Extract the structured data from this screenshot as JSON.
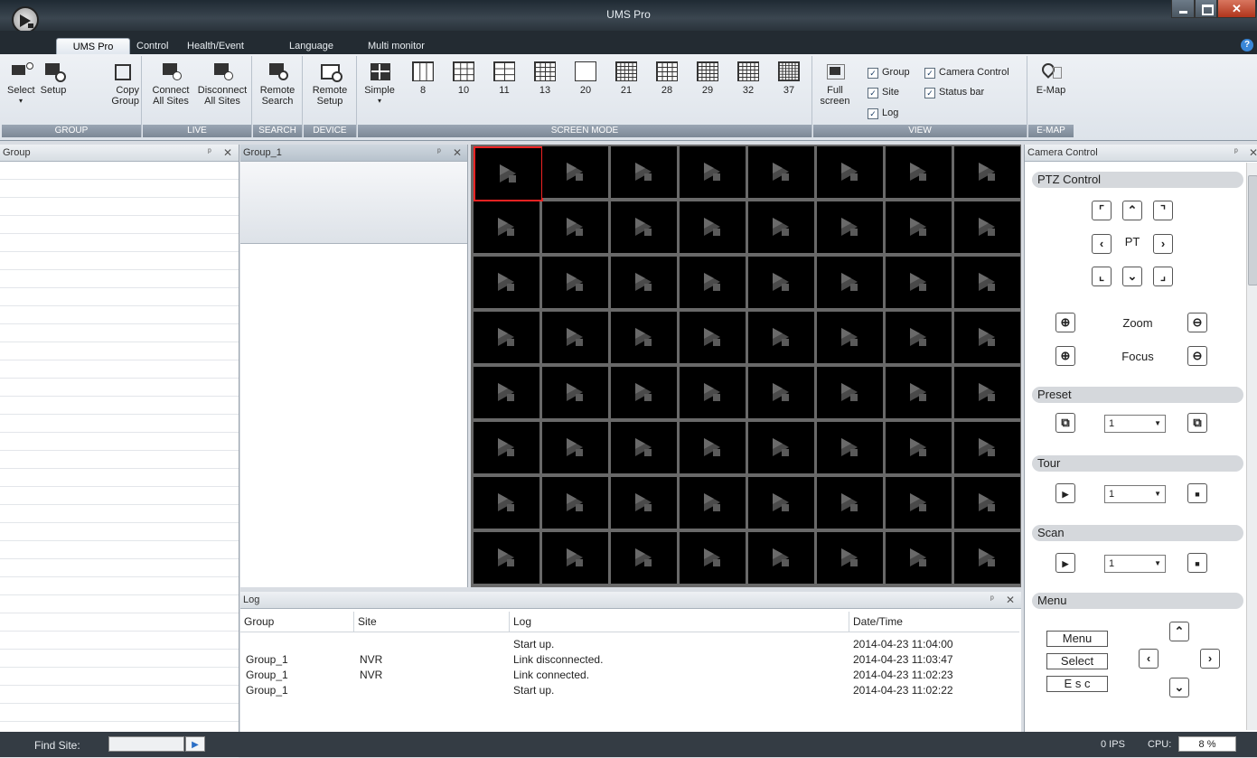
{
  "window": {
    "title": "UMS Pro"
  },
  "tabs": [
    "UMS Pro",
    "Control",
    "Health/Event",
    "Language",
    "Multi monitor"
  ],
  "ribbon": {
    "group": {
      "label": "GROUP",
      "select": "Select",
      "setup": "Setup",
      "copy1": "Copy",
      "copy2": "Group"
    },
    "live": {
      "label": "LIVE",
      "connect1": "Connect",
      "connect2": "All Sites",
      "disconnect1": "Disconnect",
      "disconnect2": "All Sites"
    },
    "search": {
      "label": "SEARCH",
      "remote1": "Remote",
      "remote2": "Search"
    },
    "device": {
      "label": "DEVICE",
      "remote1": "Remote",
      "remote2": "Setup"
    },
    "screen_mode": {
      "label": "SCREEN MODE",
      "simple": "Simple",
      "modes": [
        "8",
        "10",
        "11",
        "13",
        "20",
        "21",
        "28",
        "29",
        "32",
        "37"
      ]
    },
    "view": {
      "label": "VIEW",
      "full1": "Full",
      "full2": "screen",
      "group": "Group",
      "camera_control": "Camera Control",
      "site": "Site",
      "status_bar": "Status bar",
      "log": "Log"
    },
    "emap": {
      "label": "E-MAP",
      "button": "E-Map"
    }
  },
  "panels": {
    "group": "Group",
    "group1": "Group_1",
    "log": "Log",
    "camera_control": "Camera Control"
  },
  "log": {
    "columns": [
      "Group",
      "Site",
      "Log",
      "Date/Time"
    ],
    "rows": [
      {
        "group": "",
        "site": "",
        "log": "Start up.",
        "time": "2014-04-23 11:04:00"
      },
      {
        "group": "Group_1",
        "site": "NVR",
        "log": "Link disconnected.",
        "time": "2014-04-23 11:03:47"
      },
      {
        "group": "Group_1",
        "site": "NVR",
        "log": "Link connected.",
        "time": "2014-04-23 11:02:23"
      },
      {
        "group": "Group_1",
        "site": "",
        "log": "Start up.",
        "time": "2014-04-23 11:02:22"
      }
    ]
  },
  "camera_control": {
    "ptz_title": "PTZ Control",
    "pt": "PT",
    "zoom": "Zoom",
    "focus": "Focus",
    "preset_title": "Preset",
    "preset_value": "1",
    "tour_title": "Tour",
    "tour_value": "1",
    "scan_title": "Scan",
    "scan_value": "1",
    "menu_title": "Menu",
    "menu_btn": "Menu",
    "select_btn": "Select",
    "esc_btn": "E s c"
  },
  "status": {
    "find_site": "Find Site:",
    "ips": "0 IPS",
    "cpu_label": "CPU:",
    "cpu_value": "8 %"
  }
}
